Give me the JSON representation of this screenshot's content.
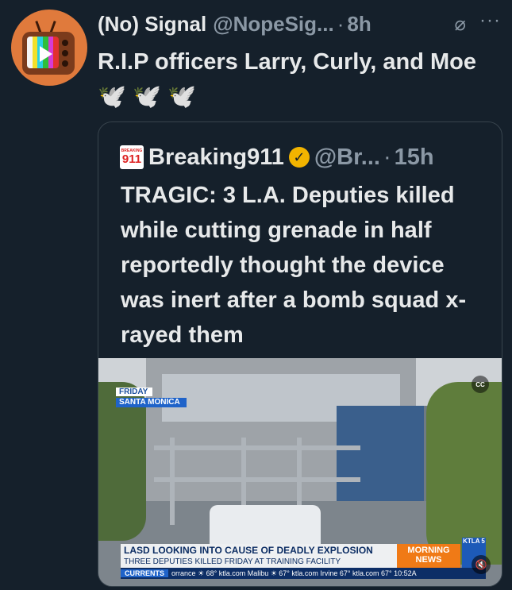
{
  "tweet": {
    "name": "(No) Signal",
    "handle": "@NopeSig...",
    "separator": "·",
    "time": "8h",
    "text": "R.I.P officers Larry, Curly, and Moe",
    "emoji": "🕊️ 🕊️ 🕊️",
    "icons": {
      "more": "more-icon",
      "no_signal": "no-signal-icon"
    }
  },
  "quote": {
    "logo_small": "BREAKING",
    "logo_big": "911",
    "name": "Breaking911",
    "verified_icon": "verified-badge-icon",
    "verified_color": "#f2b400",
    "handle": "@Br...",
    "separator": "·",
    "time": "15h",
    "text": "TRAGIC: 3 L.A. Deputies killed while cutting grenade in half reportedly thought the device was inert after a bomb squad x-rayed them"
  },
  "media": {
    "location_day": "FRIDAY",
    "location_place": "SANTA MONICA",
    "cc_label": "CC",
    "headline": "LASD LOOKING INTO CAUSE OF DEADLY EXPLOSION",
    "subline": "THREE DEPUTIES KILLED FRIDAY AT TRAINING FACILITY",
    "news_label": "MORNING NEWS",
    "station": "KTLA 5",
    "ticker_tag": "CURRENTS",
    "ticker": "orrance ☀ 68° ktla.com Malibu ☀ 67° ktla.com Irvine 67° ktla.com 67° 10:52A",
    "mute_icon": "mute-icon"
  },
  "colors": {
    "background": "#15202b",
    "text": "#e7e9ea",
    "secondary": "#8b98a5",
    "border": "#38444d"
  }
}
